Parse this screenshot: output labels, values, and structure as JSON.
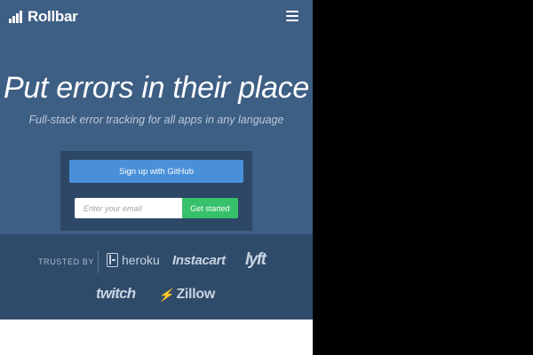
{
  "header": {
    "logo_text": "Rollbar",
    "logo_icon": "rollbar-bars-icon",
    "menu_icon": "hamburger-menu-icon"
  },
  "hero": {
    "headline": "Put errors in their place",
    "subheadline": "Full-stack error tracking for all apps in any language"
  },
  "signup": {
    "github_button_label": "Sign up with GitHub",
    "email_placeholder": "Enter your email",
    "email_value": "",
    "get_started_label": "Get started"
  },
  "trusted": {
    "label": "TRUSTED BY",
    "brands": {
      "heroku": "heroku",
      "instacart": "Instacart",
      "lyft": "lyft",
      "twitch": "twitch",
      "zillow": "Zillow"
    }
  },
  "colors": {
    "hero_background": "#3e5f84",
    "signup_box_background": "#2d4766",
    "github_button": "#4a90d9",
    "get_started_button": "#37c16b",
    "trusted_background": "#2f4b6a"
  }
}
